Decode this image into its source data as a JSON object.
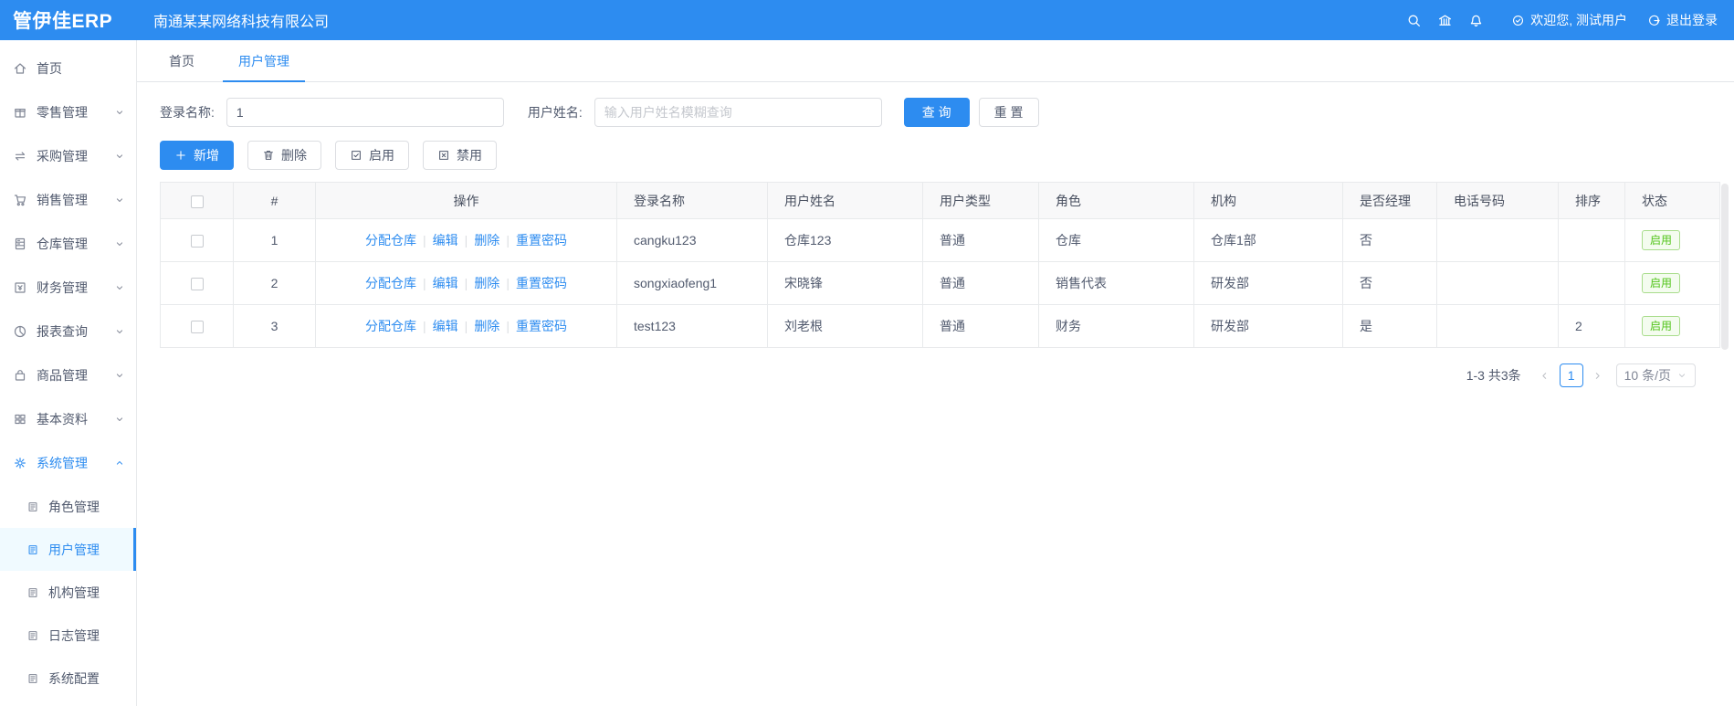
{
  "colors": {
    "primary": "#2d8cf0",
    "success": "#52c41a",
    "header_bg": "#2d8cf0"
  },
  "header": {
    "logo": "管伊佳ERP",
    "company": "南通某某网络科技有限公司",
    "welcome": "欢迎您, 测试用户",
    "logout": "退出登录"
  },
  "sidebar": {
    "items": [
      {
        "label": "首页",
        "icon": "home-icon",
        "arrow": null,
        "active": false
      },
      {
        "label": "零售管理",
        "icon": "retail-icon",
        "arrow": "down",
        "active": false
      },
      {
        "label": "采购管理",
        "icon": "purchase-icon",
        "arrow": "down",
        "active": false
      },
      {
        "label": "销售管理",
        "icon": "sales-icon",
        "arrow": "down",
        "active": false
      },
      {
        "label": "仓库管理",
        "icon": "warehouse-icon",
        "arrow": "down",
        "active": false
      },
      {
        "label": "财务管理",
        "icon": "finance-icon",
        "arrow": "down",
        "active": false
      },
      {
        "label": "报表查询",
        "icon": "report-icon",
        "arrow": "down",
        "active": false
      },
      {
        "label": "商品管理",
        "icon": "goods-icon",
        "arrow": "down",
        "active": false
      },
      {
        "label": "基本资料",
        "icon": "basic-icon",
        "arrow": "down",
        "active": false
      },
      {
        "label": "系统管理",
        "icon": "system-icon",
        "arrow": "up",
        "active": true,
        "children": [
          {
            "label": "角色管理",
            "active": false
          },
          {
            "label": "用户管理",
            "active": true
          },
          {
            "label": "机构管理",
            "active": false
          },
          {
            "label": "日志管理",
            "active": false
          },
          {
            "label": "系统配置",
            "active": false
          }
        ]
      }
    ]
  },
  "tabs": [
    {
      "label": "首页",
      "active": false
    },
    {
      "label": "用户管理",
      "active": true
    }
  ],
  "filters": {
    "login_name_label": "登录名称:",
    "login_name_value": "1",
    "user_name_label": "用户姓名:",
    "user_name_placeholder": "输入用户姓名模糊查询",
    "search_label": "查 询",
    "reset_label": "重 置"
  },
  "toolbar": {
    "add": "新增",
    "delete": "删除",
    "enable": "启用",
    "disable": "禁用"
  },
  "table": {
    "columns": [
      "#",
      "操作",
      "登录名称",
      "用户姓名",
      "用户类型",
      "角色",
      "机构",
      "是否经理",
      "电话号码",
      "排序",
      "状态"
    ],
    "action_links": [
      "分配仓库",
      "编辑",
      "删除",
      "重置密码"
    ],
    "rows": [
      {
        "index": "1",
        "login": "cangku123",
        "name": "仓库123",
        "type": "普通",
        "role": "仓库",
        "org": "仓库1部",
        "manager": "否",
        "phone": "",
        "sort": "",
        "status": "启用"
      },
      {
        "index": "2",
        "login": "songxiaofeng1",
        "name": "宋晓锋",
        "type": "普通",
        "role": "销售代表",
        "org": "研发部",
        "manager": "否",
        "phone": "",
        "sort": "",
        "status": "启用"
      },
      {
        "index": "3",
        "login": "test123",
        "name": "刘老根",
        "type": "普通",
        "role": "财务",
        "org": "研发部",
        "manager": "是",
        "phone": "",
        "sort": "2",
        "status": "启用"
      }
    ]
  },
  "pagination": {
    "total": "1-3 共3条",
    "current_page": "1",
    "page_size": "10 条/页"
  }
}
